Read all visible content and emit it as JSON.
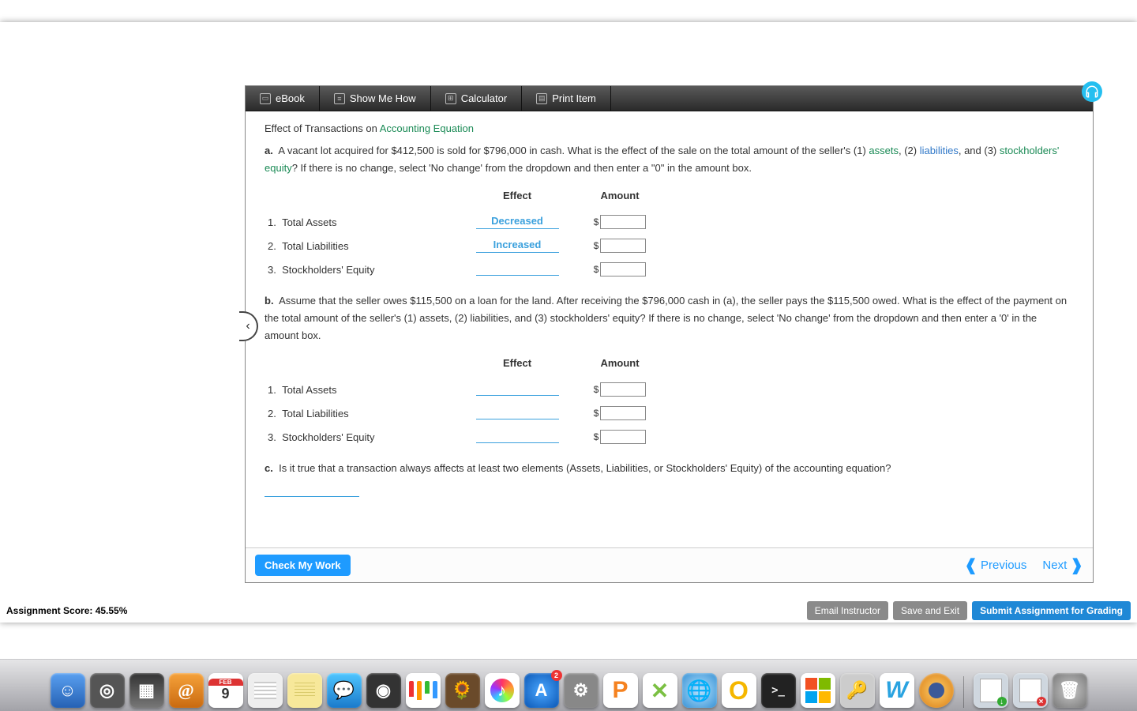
{
  "toolbar": {
    "ebook": "eBook",
    "show_me_how": "Show Me How",
    "calculator": "Calculator",
    "print_item": "Print Item"
  },
  "title_prefix": "Effect of Transactions on ",
  "title_link": "Accounting Equation",
  "part_a": {
    "label": "a.",
    "text1": "A vacant lot acquired for $412,500 is sold for $796,000 in cash. What is the effect of the sale on the total amount of the seller's (1) ",
    "assets": "assets",
    "text2": ", (2) ",
    "liabilities": "liabilities",
    "text3": ", and (3) ",
    "equity": "stockholders' equity",
    "text4": "? If there is no change, select 'No change' from the dropdown and then enter a \"0\" in the amount box."
  },
  "headers": {
    "effect": "Effect",
    "amount": "Amount"
  },
  "rows_a": [
    {
      "num": "1.",
      "label": "Total Assets",
      "effect": "Decreased"
    },
    {
      "num": "2.",
      "label": "Total Liabilities",
      "effect": "Increased"
    },
    {
      "num": "3.",
      "label": "Stockholders' Equity",
      "effect": ""
    }
  ],
  "part_b": {
    "label": "b.",
    "text": "Assume that the seller owes $115,500 on a loan for the land. After receiving the $796,000 cash in (a), the seller pays the $115,500 owed. What is the effect of the payment on the total amount of the seller's (1) assets, (2) liabilities, and (3) stockholders' equity? If there is no change, select 'No change' from the dropdown and then enter a '0' in the amount box."
  },
  "rows_b": [
    {
      "num": "1.",
      "label": "Total Assets",
      "effect": ""
    },
    {
      "num": "2.",
      "label": "Total Liabilities",
      "effect": ""
    },
    {
      "num": "3.",
      "label": "Stockholders' Equity",
      "effect": ""
    }
  ],
  "part_c": {
    "label": "c.",
    "text": "Is it true that a transaction always affects at least two elements (Assets, Liabilities, or Stockholders' Equity) of the accounting equation?"
  },
  "buttons": {
    "check": "Check My Work",
    "previous": "Previous",
    "next": "Next",
    "email": "Email Instructor",
    "save": "Save and Exit",
    "submit": "Submit Assignment for Grading"
  },
  "footer_label": "Assignment Score: ",
  "footer_score": "45.55%",
  "dock_date": "9",
  "dollar": "$"
}
